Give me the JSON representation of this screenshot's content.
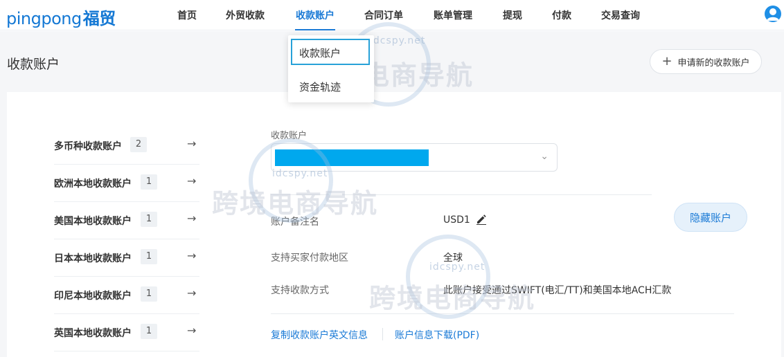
{
  "brand": {
    "logo_en": "pingpong",
    "logo_cn": "福贸"
  },
  "nav": {
    "items": [
      "首页",
      "外贸收款",
      "收款账户",
      "合同订单",
      "账单管理",
      "提现",
      "付款",
      "交易查询"
    ],
    "active": "收款账户"
  },
  "dropdown": {
    "items": [
      "收款账户",
      "资金轨迹"
    ],
    "selected": "收款账户"
  },
  "page": {
    "title": "收款账户",
    "apply_button": "申请新的收款账户"
  },
  "accounts": [
    {
      "label": "多币种收款账户",
      "count": "2"
    },
    {
      "label": "欧洲本地收款账户",
      "count": "1"
    },
    {
      "label": "美国本地收款账户",
      "count": "1"
    },
    {
      "label": "日本本地收款账户",
      "count": "1"
    },
    {
      "label": "印尼本地收款账户",
      "count": "1"
    },
    {
      "label": "英国本地收款账户",
      "count": "1"
    }
  ],
  "details": {
    "select_label": "收款账户",
    "remark_label": "账户备注名",
    "remark_value": "USD1",
    "region_label": "支持买家付款地区",
    "region_value": "全球",
    "method_label": "支持收款方式",
    "method_value": "此账户接受通过SWIFT(电汇/TT)和美国本地ACH汇款",
    "hide_button": "隐藏账户",
    "copy_link": "复制收款账户英文信息",
    "download_link": "账户信息下载(PDF)"
  },
  "watermark": {
    "text": "跨境电商导航",
    "url": "idcspy.net"
  },
  "colors": {
    "accent": "#1a7ad6",
    "redaction": "#00a8ee"
  }
}
